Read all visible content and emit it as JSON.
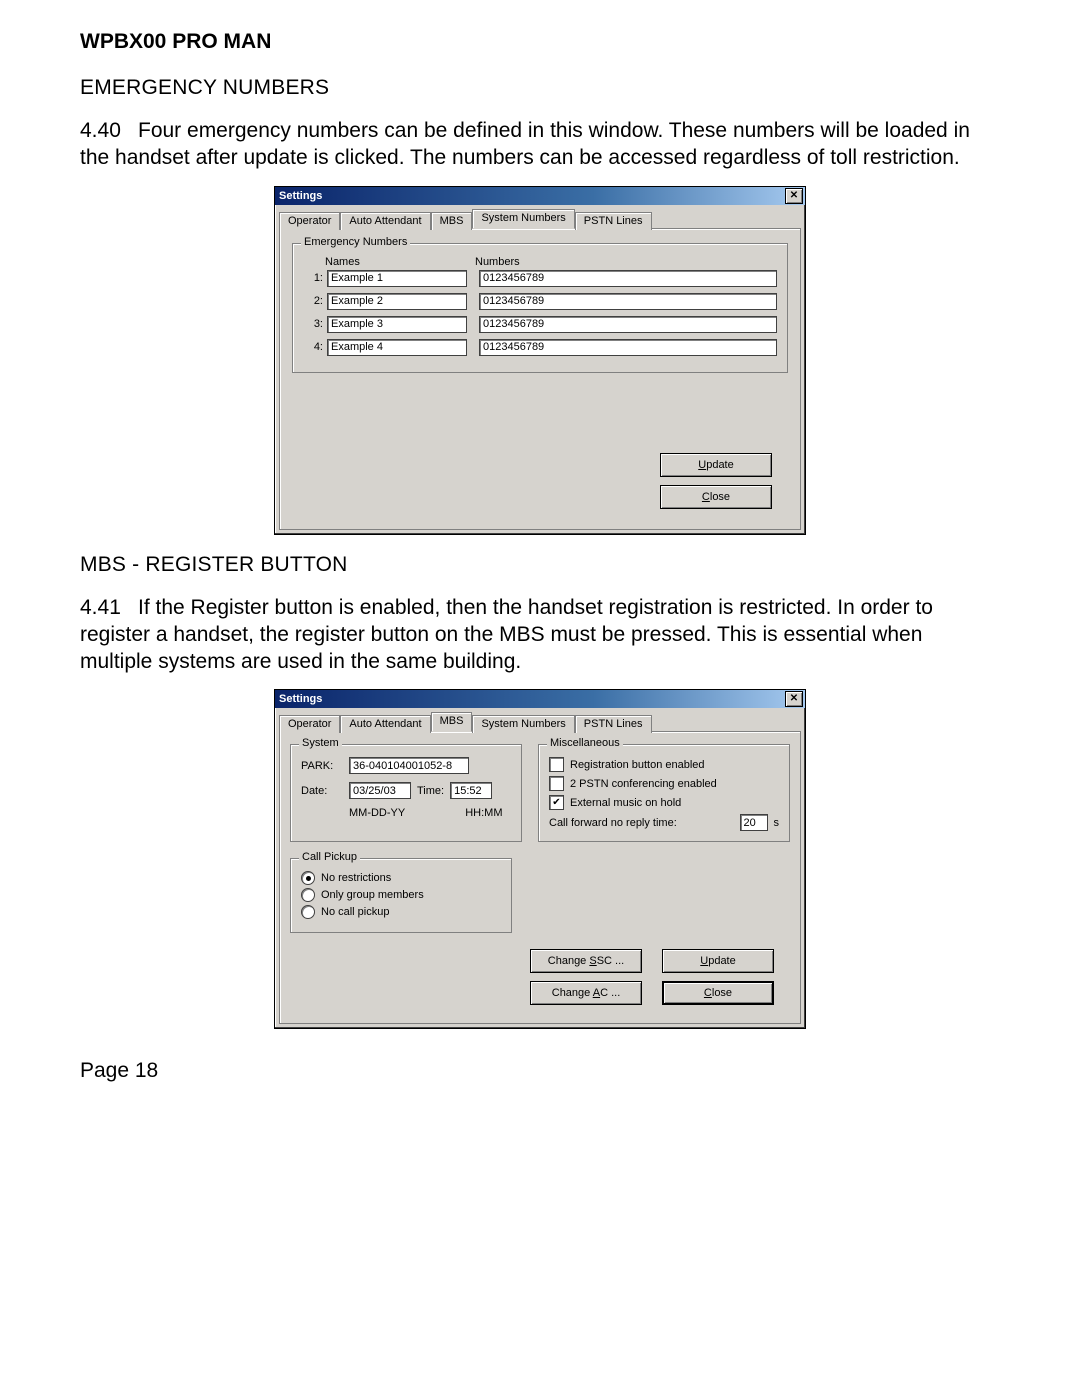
{
  "doc_header": "WPBX00 PRO MAN",
  "section1": {
    "title": "EMERGENCY NUMBERS",
    "para_num": "4.40",
    "para_text": "Four emergency numbers can be defined in this window.  These numbers will be loaded in the handset after update is clicked.  The numbers can be accessed regardless of toll restriction."
  },
  "dialog1": {
    "title": "Settings",
    "tabs": [
      "Operator",
      "Auto Attendant",
      "MBS",
      "System Numbers",
      "PSTN Lines"
    ],
    "active_tab": 3,
    "group_label": "Emergency Numbers",
    "col_names": "Names",
    "col_numbers": "Numbers",
    "rows": [
      {
        "idx": "1:",
        "name": "Example 1",
        "number": "0123456789"
      },
      {
        "idx": "2:",
        "name": "Example 2",
        "number": "0123456789"
      },
      {
        "idx": "3:",
        "name": "Example 3",
        "number": "0123456789"
      },
      {
        "idx": "4:",
        "name": "Example 4",
        "number": "0123456789"
      }
    ],
    "update_btn": "Update",
    "update_accel": "U",
    "close_btn": "Close",
    "close_accel": "C"
  },
  "section2": {
    "title": "MBS - REGISTER BUTTON",
    "para_num": "4.41",
    "para_text": "If the Register button is enabled, then the handset registration is restricted.  In order to register a handset, the register button on the MBS must be pressed.  This is essential when multiple systems are used in the same building."
  },
  "dialog2": {
    "title": "Settings",
    "tabs": [
      "Operator",
      "Auto Attendant",
      "MBS",
      "System Numbers",
      "PSTN Lines"
    ],
    "active_tab": 2,
    "system": {
      "legend": "System",
      "park_label": "PARK:",
      "park_value": "36-040104001052-8",
      "date_label": "Date:",
      "date_value": "03/25/03",
      "time_label": "Time:",
      "time_value": "15:52",
      "date_hint": "MM-DD-YY",
      "time_hint": "HH:MM"
    },
    "misc": {
      "legend": "Miscellaneous",
      "reg_label": "Registration button enabled",
      "reg_checked": false,
      "conf_label": "2 PSTN conferencing enabled",
      "conf_checked": false,
      "ext_label": "External music on hold",
      "ext_checked": true,
      "cf_label": "Call forward no reply time:",
      "cf_value": "20",
      "cf_unit": "s"
    },
    "callpickup": {
      "legend": "Call Pickup",
      "options": [
        "No restrictions",
        "Only group members",
        "No call pickup"
      ],
      "selected": 0
    },
    "buttons": {
      "change_ssc": "Change SSC ...",
      "ssc_accel": "S",
      "change_ac": "Change AC ...",
      "ac_accel": "A",
      "update": "Update",
      "update_accel": "U",
      "close": "Close",
      "close_accel": "C"
    }
  },
  "page_label": "Page 18"
}
